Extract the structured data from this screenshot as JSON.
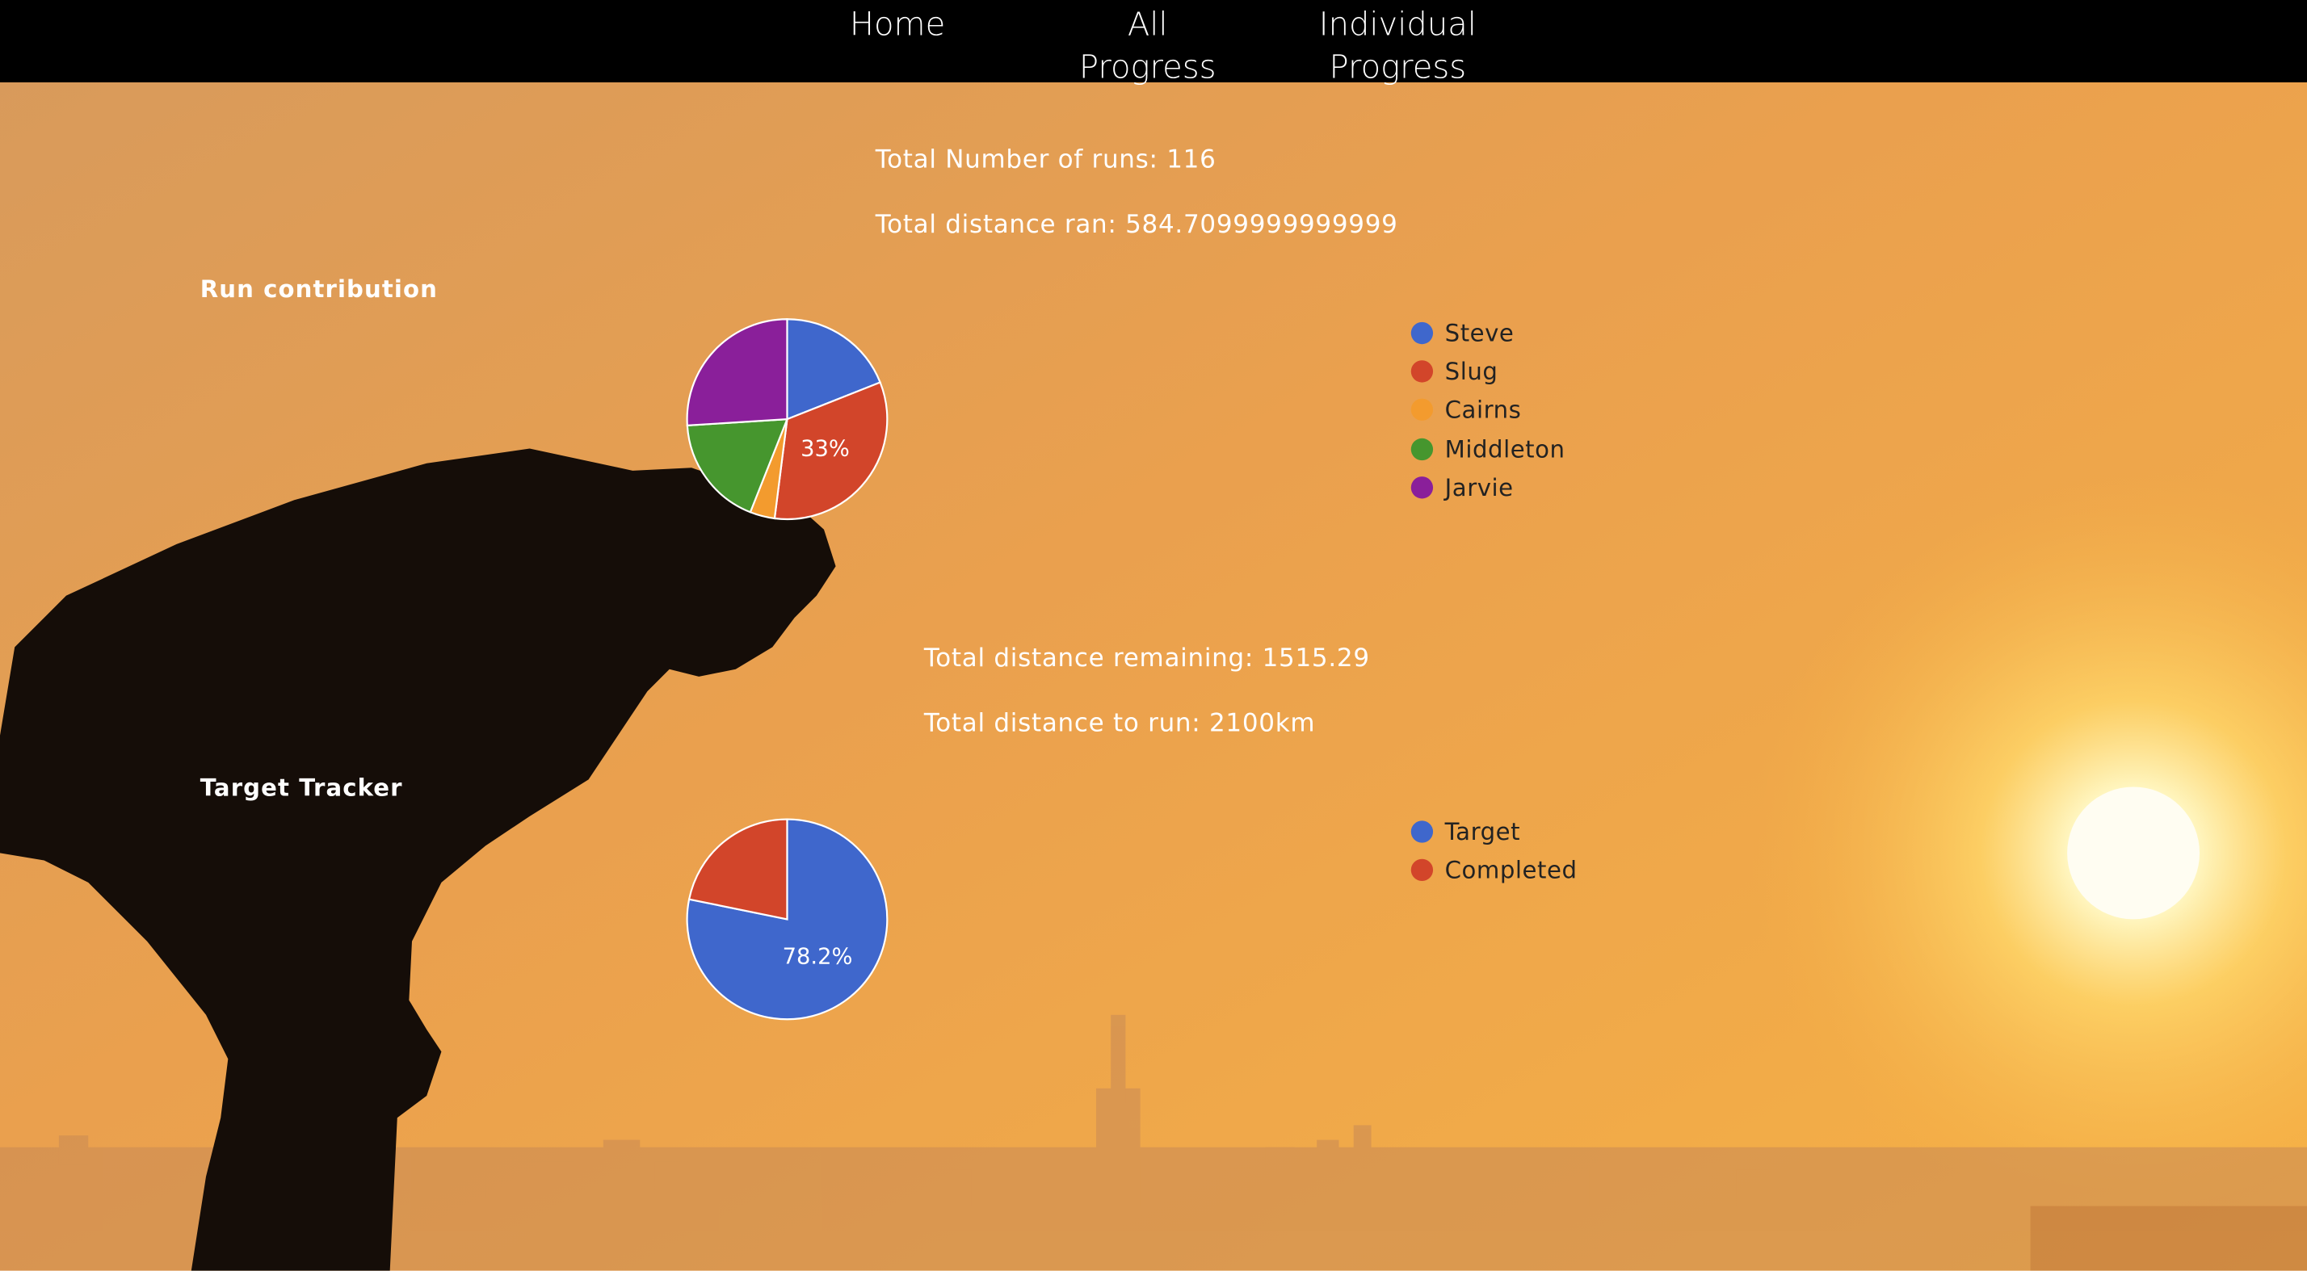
{
  "nav": {
    "home": "Home",
    "all_progress": "All\nProgress",
    "individual_progress": "Individual\nProgress"
  },
  "stats": {
    "total_runs": "Total Number of runs: 116",
    "total_distance": "Total distance ran: 584.7099999999999",
    "distance_remaining": "Total distance remaining: 1515.29",
    "distance_to_run": "Total distance to run: 2100km"
  },
  "chart_data": [
    {
      "type": "pie",
      "title": "Run contribution",
      "series": [
        {
          "name": "Steve",
          "value": 19,
          "color": "#3f67cc"
        },
        {
          "name": "Slug",
          "value": 33,
          "color": "#d2452a"
        },
        {
          "name": "Cairns",
          "value": 4,
          "color": "#f39b2e"
        },
        {
          "name": "Middleton",
          "value": 18,
          "color": "#46962e"
        },
        {
          "name": "Jarvie",
          "value": 26,
          "color": "#8a1f9a"
        }
      ],
      "slice_labels": {
        "Slug": "33%"
      },
      "legend_position": "right"
    },
    {
      "type": "pie",
      "title": "Target Tracker",
      "series": [
        {
          "name": "Target",
          "value": 78.2,
          "color": "#3f67cc"
        },
        {
          "name": "Completed",
          "value": 21.8,
          "color": "#d2452a"
        }
      ],
      "slice_labels": {
        "Target": "78.2%"
      },
      "legend_position": "right"
    }
  ],
  "background": {
    "sky_color": "#f3a24a",
    "sun_color": "#fff8c8",
    "silhouette_color": "#150d08"
  }
}
